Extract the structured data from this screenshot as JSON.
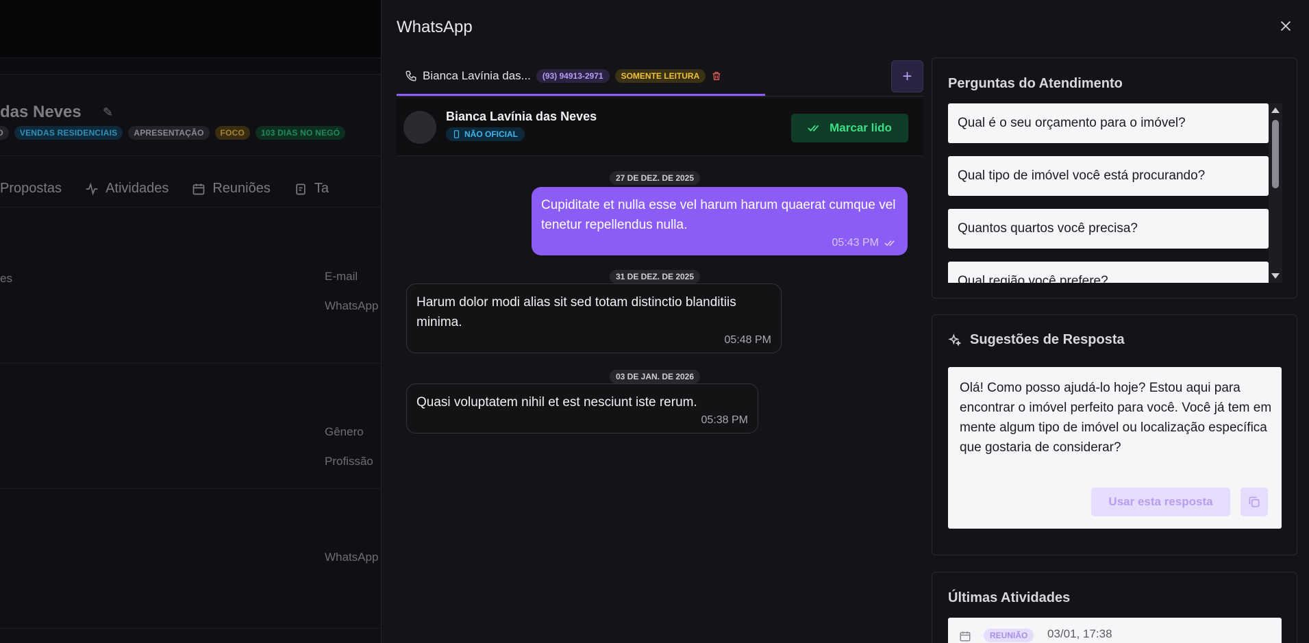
{
  "background": {
    "title": "das Neves",
    "tags": [
      {
        "label": "TO",
        "style": "gray"
      },
      {
        "label": "VENDAS RESIDENCIAIS",
        "style": "blue"
      },
      {
        "label": "APRESENTAÇÃO",
        "style": "gray"
      },
      {
        "label": "FOCO",
        "style": "gold"
      },
      {
        "label": "103 DIAS NO NEGÓ",
        "style": "green"
      }
    ],
    "tabs": [
      "Propostas",
      "Atividades",
      "Reuniões",
      "Ta"
    ],
    "labels": {
      "left_es": "es",
      "email": "E-mail",
      "whatsapp_1": "WhatsApp",
      "genero": "Gênero",
      "profissao": "Profissão",
      "whatsapp_2": "WhatsApp"
    }
  },
  "panel": {
    "title": "WhatsApp",
    "conversation_tab": {
      "name": "Bianca Lavínia das...",
      "phone": "(93) 94913-2971",
      "status": "SOMENTE LEITURA"
    },
    "contact": {
      "name": "Bianca Lavínia das Neves",
      "badge": "NÃO OFICIAL",
      "mark_read_label": "Marcar lido"
    },
    "messages": [
      {
        "type": "date",
        "text": "27 DE DEZ. DE 2025"
      },
      {
        "type": "out",
        "text": "Cupiditate et nulla esse vel harum harum quaerat cumque vel tenetur repellendus nulla.",
        "time": "05:43 PM"
      },
      {
        "type": "date",
        "text": "31 DE DEZ. DE 2025"
      },
      {
        "type": "in",
        "text": "Harum dolor modi alias sit sed totam distinctio blanditiis minima.",
        "time": "05:48 PM"
      },
      {
        "type": "date",
        "text": "03 DE JAN. DE 2026"
      },
      {
        "type": "in",
        "text": "Quasi voluptatem nihil et est nesciunt iste rerum.",
        "time": "05:38 PM"
      }
    ]
  },
  "questions": {
    "title": "Perguntas do Atendimento",
    "items": [
      "Qual é o seu orçamento para o imóvel?",
      "Qual tipo de imóvel você está procurando?",
      "Quantos quartos você precisa?",
      "Qual região você prefere?"
    ]
  },
  "suggestions": {
    "title": "Sugestões de Resposta",
    "text": "Olá! Como posso ajudá-lo hoje? Estou aqui para encontrar o imóvel perfeito para você. Você já tem em mente algum tipo de imóvel ou localização específica que gostaria de considerar?",
    "use_label": "Usar esta resposta"
  },
  "activities": {
    "title": "Últimas Atividades",
    "items": [
      {
        "badge": "REUNIÃO",
        "time": "03/01, 17:38"
      }
    ]
  },
  "colors": {
    "accent": "#8b5cf6",
    "read_only": "#f0c13a",
    "success": "#3dde86",
    "unofficial": "#43b2ea"
  }
}
